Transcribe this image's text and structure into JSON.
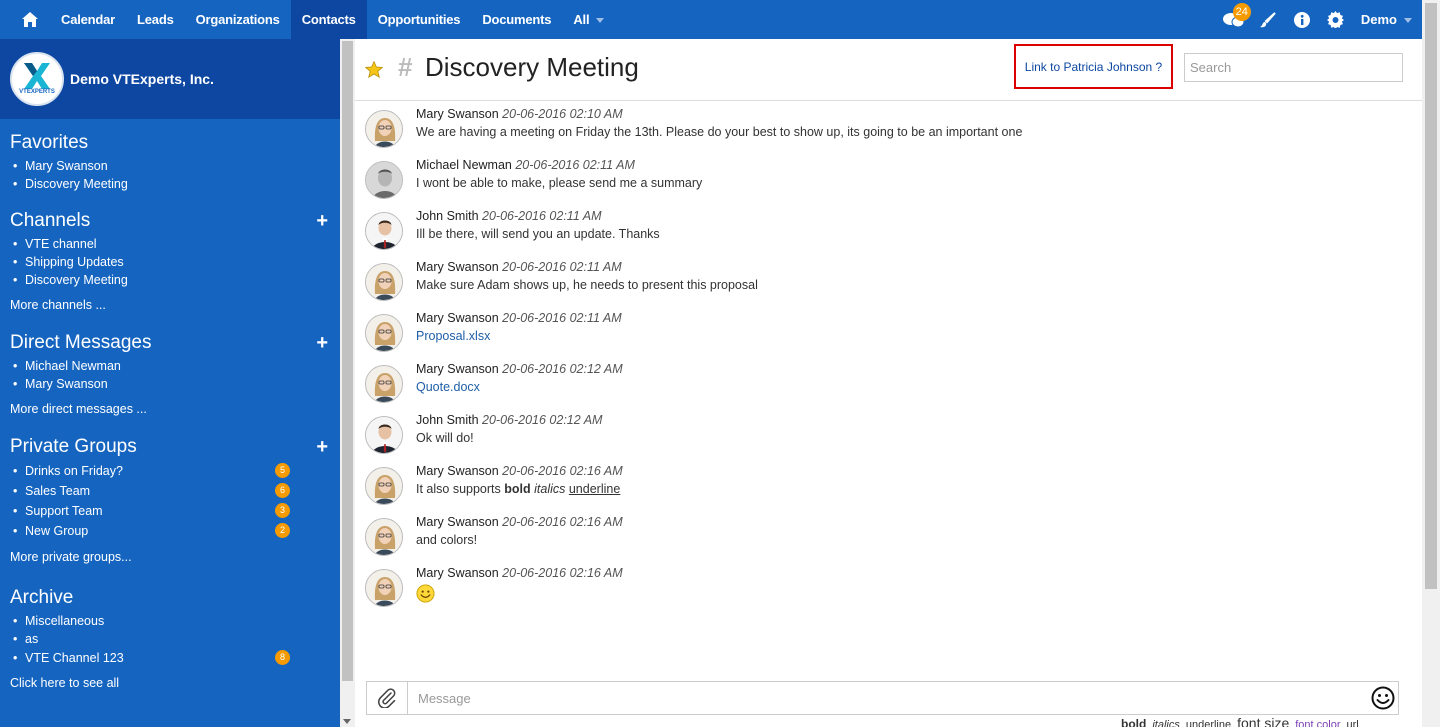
{
  "nav": {
    "items": [
      "Calendar",
      "Leads",
      "Organizations",
      "Contacts",
      "Opportunities",
      "Documents",
      "All"
    ],
    "active": "Contacts",
    "notification_count": "24",
    "user": "Demo"
  },
  "sidebar": {
    "brand": "Demo VTExperts, Inc.",
    "brand_logo_text": "VTEXPERTS",
    "favorites": {
      "title": "Favorites",
      "items": [
        "Mary Swanson",
        "Discovery Meeting"
      ]
    },
    "channels": {
      "title": "Channels",
      "items": [
        "VTE channel",
        "Shipping Updates",
        "Discovery Meeting"
      ],
      "more": "More channels ..."
    },
    "direct": {
      "title": "Direct Messages",
      "items": [
        "Michael Newman",
        "Mary Swanson"
      ],
      "more": "More direct messages ..."
    },
    "groups": {
      "title": "Private Groups",
      "items": [
        {
          "label": "Drinks on Friday?",
          "count": "5"
        },
        {
          "label": "Sales Team",
          "count": "6"
        },
        {
          "label": "Support Team",
          "count": "3"
        },
        {
          "label": "New Group",
          "count": "2"
        }
      ],
      "more": "More private groups..."
    },
    "archive": {
      "title": "Archive",
      "items": [
        {
          "label": "Miscellaneous",
          "count": ""
        },
        {
          "label": "as",
          "count": ""
        },
        {
          "label": "VTE Channel 123",
          "count": "8"
        }
      ],
      "more": "Click here to see all"
    }
  },
  "header": {
    "hash": "#",
    "title": "Discovery Meeting",
    "link": "Link to Patricia Johnson ?",
    "search_placeholder": "Search"
  },
  "messages": [
    {
      "author": "Mary Swanson",
      "time": "20-06-2016 02:10 AM",
      "text": "We are having a meeting on Friday the 13th. Please do your best to show up, its going to be an important one",
      "avatar": "female"
    },
    {
      "author": "Michael Newman",
      "time": "20-06-2016 02:11 AM",
      "text": "I wont be able to make, please send me a summary",
      "avatar": "male-gray"
    },
    {
      "author": "John Smith",
      "time": "20-06-2016 02:11 AM",
      "text": "Ill be there, will send you an update. Thanks",
      "avatar": "male-suit"
    },
    {
      "author": "Mary Swanson",
      "time": "20-06-2016 02:11 AM",
      "text": "Make sure Adam shows up, he needs to present this proposal",
      "avatar": "female"
    },
    {
      "author": "Mary Swanson",
      "time": "20-06-2016 02:11 AM",
      "text": "Proposal.xlsx",
      "avatar": "female",
      "is_file": true
    },
    {
      "author": "Mary Swanson",
      "time": "20-06-2016 02:12 AM",
      "text": "Quote.docx",
      "avatar": "female",
      "is_file": true
    },
    {
      "author": "John Smith",
      "time": "20-06-2016 02:12 AM",
      "text": "Ok will do!",
      "avatar": "male-suit"
    },
    {
      "author": "Mary Swanson",
      "time": "20-06-2016 02:16 AM",
      "text": "",
      "avatar": "female",
      "rich": {
        "prefix": "It also supports",
        "bold": "bold",
        "italic": "italics",
        "underline": "underline"
      }
    },
    {
      "author": "Mary Swanson",
      "time": "20-06-2016 02:16 AM",
      "text": "and colors!",
      "avatar": "female"
    },
    {
      "author": "Mary Swanson",
      "time": "20-06-2016 02:16 AM",
      "text": "",
      "avatar": "female",
      "emoji": "smiley"
    }
  ],
  "composer": {
    "placeholder": "Message",
    "formats": [
      "bold",
      "italics",
      "underline",
      "font size",
      "font color",
      "url"
    ]
  },
  "colors": {
    "nav_bg": "#1565c0",
    "nav_active": "#0d47a1",
    "badge": "#f59b00",
    "link": "#1f5fa8",
    "highlight_border": "#dd0000"
  }
}
